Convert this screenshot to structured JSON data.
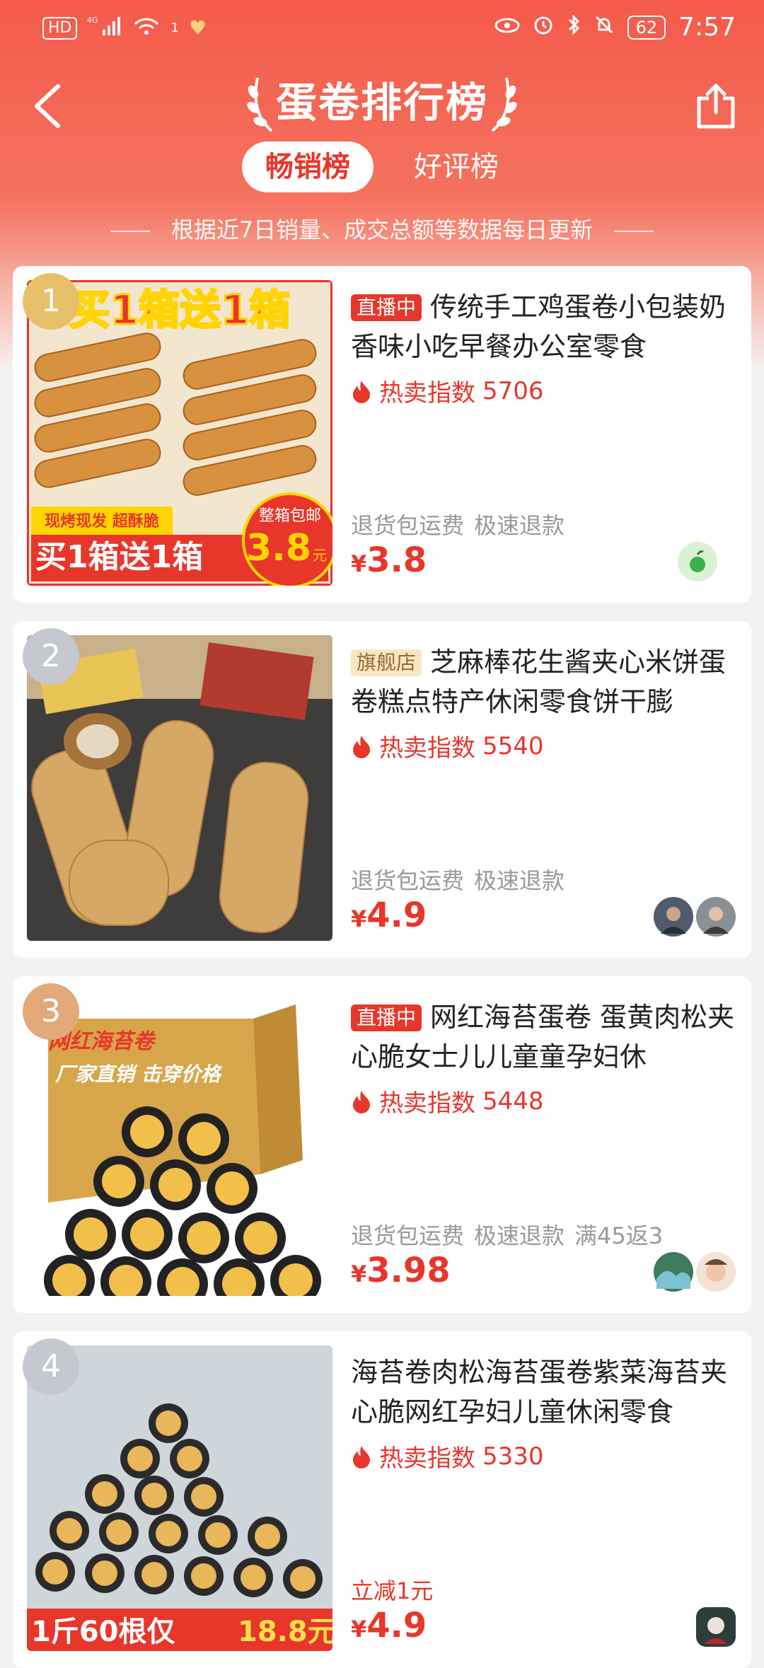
{
  "status": {
    "left": [
      "HD",
      "4G",
      "1",
      "♥"
    ],
    "battery": "62",
    "time": "7:57"
  },
  "nav": {
    "title": "蛋卷排行榜",
    "tabs": [
      {
        "label": "畅销榜",
        "active": true
      },
      {
        "label": "好评榜",
        "active": false
      }
    ],
    "subtitle": "根据近7日销量、成交总额等数据每日更新"
  },
  "products": [
    {
      "rank": "1",
      "tag": "直播中",
      "tag_type": "live",
      "title": "传统手工鸡蛋卷小包装奶香味小吃早餐办公室零食",
      "hot_label": "热卖指数",
      "hot_value": "5706",
      "meta": [
        "退货包运费",
        "极速退款"
      ],
      "promo": "",
      "currency": "¥",
      "price": "3.8",
      "image_text": {
        "banner": "买1箱送1箱",
        "badge1": "现烤现发 超酥脆",
        "bottom": "买1箱送1箱",
        "corner_top": "整箱包邮",
        "corner_price": "3.8",
        "corner_unit": "元"
      }
    },
    {
      "rank": "2",
      "tag": "旗舰店",
      "tag_type": "flag",
      "title": "芝麻棒花生酱夹心米饼蛋卷糕点特产休闲零食饼干膨",
      "hot_label": "热卖指数",
      "hot_value": "5540",
      "meta": [
        "退货包运费",
        "极速退款"
      ],
      "promo": "",
      "currency": "¥",
      "price": "4.9"
    },
    {
      "rank": "3",
      "tag": "直播中",
      "tag_type": "live",
      "title": "网红海苔蛋卷 蛋黄肉松夹心脆女士儿儿童童孕妇休",
      "hot_label": "热卖指数",
      "hot_value": "5448",
      "meta": [
        "退货包运费",
        "极速退款",
        "满45返3"
      ],
      "promo": "",
      "currency": "¥",
      "price": "3.98",
      "image_text": {
        "top": "网红海苔卷",
        "second": "厂家直销 击穿价格"
      }
    },
    {
      "rank": "4",
      "tag": "",
      "tag_type": "",
      "title": "海苔卷肉松海苔蛋卷紫菜海苔夹心脆网红孕妇儿童休闲零食",
      "hot_label": "热卖指数",
      "hot_value": "5330",
      "meta": [],
      "promo": "立减1元",
      "currency": "¥",
      "price": "4.9",
      "image_text": {
        "bottom_a": "1斤60根仅",
        "bottom_b": "18.8元"
      }
    }
  ],
  "colors": {
    "accent": "#e8362b",
    "header": "#f45a4a",
    "rank1": "#e7c06a",
    "rank2": "#c5c9cf",
    "rank3": "#e2a97a",
    "rank4": "#c5c9cf"
  }
}
